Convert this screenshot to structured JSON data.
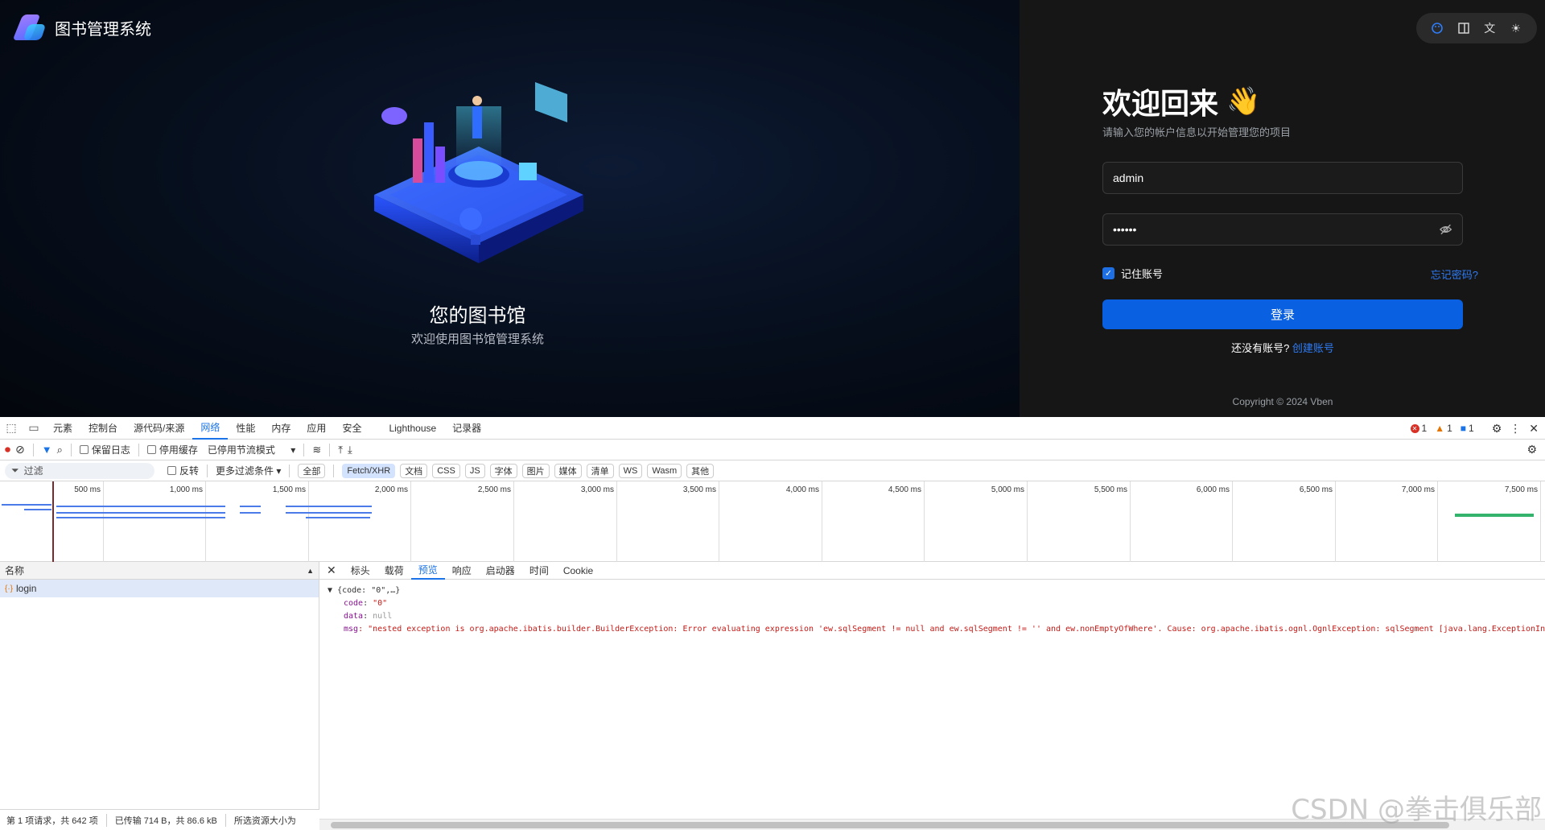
{
  "brand": {
    "name": "图书管理系统"
  },
  "hero": {
    "title": "您的图书馆",
    "subtitle": "欢迎使用图书馆管理系统"
  },
  "toolbar": {
    "icons": [
      "palette-icon",
      "layout-icon",
      "translate-icon",
      "sun-icon"
    ]
  },
  "login": {
    "title": "欢迎回来",
    "subtitle": "请输入您的帐户信息以开始管理您的项目",
    "username_value": "admin",
    "password_value": "••••••",
    "remember_label": "记住账号",
    "remember_checked": true,
    "forgot_label": "忘记密码?",
    "submit_label": "登录",
    "no_account_text": "还没有账号?",
    "create_account_label": "创建账号",
    "copyright": "Copyright © 2024 Vben"
  },
  "devtools": {
    "tabs": [
      "元素",
      "控制台",
      "源代码/来源",
      "网络",
      "性能",
      "内存",
      "应用",
      "安全",
      "Lighthouse",
      "记录器"
    ],
    "active_tab": "网络",
    "errors": "1",
    "warnings": "1",
    "messages": "1",
    "preserve_log": "保留日志",
    "disable_cache": "停用缓存",
    "throttle": "已停用节流模式",
    "filter_placeholder": "过滤",
    "invert": "反转",
    "more_filters": "更多过滤条件",
    "chips": [
      "全部",
      "Fetch/XHR",
      "文档",
      "CSS",
      "JS",
      "字体",
      "图片",
      "媒体",
      "清单",
      "WS",
      "Wasm",
      "其他"
    ],
    "active_chip": "Fetch/XHR",
    "timeline_labels": [
      "500 ms",
      "1,000 ms",
      "1,500 ms",
      "2,000 ms",
      "2,500 ms",
      "3,000 ms",
      "3,500 ms",
      "4,000 ms",
      "4,500 ms",
      "5,000 ms",
      "5,500 ms",
      "6,000 ms",
      "6,500 ms",
      "7,000 ms",
      "7,500 ms"
    ],
    "name_header": "名称",
    "requests": [
      "login"
    ],
    "detail_tabs": [
      "标头",
      "载荷",
      "预览",
      "响应",
      "启动器",
      "时间",
      "Cookie"
    ],
    "active_detail_tab": "预览",
    "preview": {
      "summary": "{code: \"0\",…}",
      "code_key": "code",
      "code_value": "\"0\"",
      "data_key": "data",
      "data_value": "null",
      "msg_key": "msg",
      "msg_value": "\"nested exception is org.apache.ibatis.builder.BuilderException: Error evaluating expression 'ew.sqlSegment != null and ew.sqlSegment != '' and ew.nonEmptyOfWhere'. Cause: org.apache.ibatis.ognl.OgnlException: sqlSegment [java.lang.ExceptionIn"
    },
    "status": {
      "requests": "第 1 项请求，共 642 项",
      "transferred": "已传输 714 B，共 86.6 kB",
      "resources": "所选资源大小为"
    }
  },
  "watermark": "CSDN @拳击俱乐部"
}
